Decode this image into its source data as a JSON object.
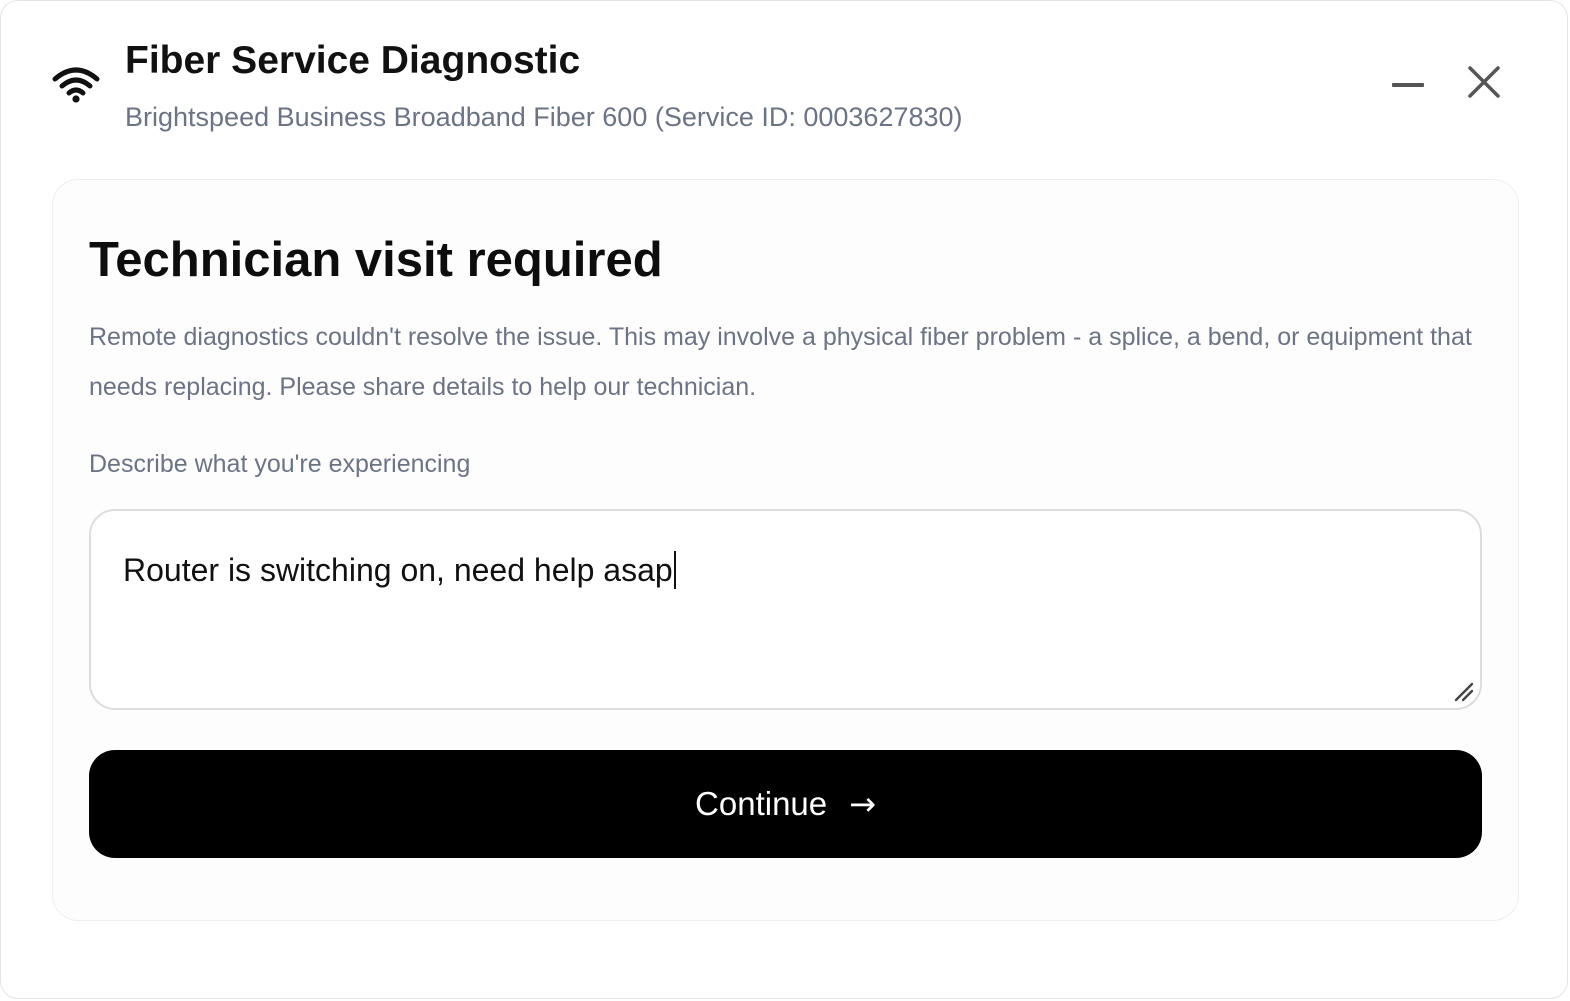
{
  "window": {
    "title": "Fiber Service Diagnostic",
    "subtitle": "Brightspeed Business Broadband Fiber 600 (Service ID: 0003627830)",
    "icon": "wifi-icon",
    "controls": {
      "minimize_icon": "minimize-icon",
      "close_icon": "close-icon"
    }
  },
  "card": {
    "title": "Technician visit required",
    "description": "Remote diagnostics couldn't resolve the issue. This may involve a physical fiber problem - a splice, a bend, or equipment that needs replacing. Please share details to help our technician.",
    "field": {
      "label": "Describe what you're experiencing",
      "value": "Router is switching on, need help asap"
    },
    "continue_button": {
      "label": "Continue",
      "icon": "arrow-right-icon",
      "arrow_glyph": "→"
    }
  },
  "colors": {
    "primary_button": "#000000",
    "muted_text": "#6b7385",
    "heading_text": "#111111",
    "border": "#dcdde1"
  }
}
